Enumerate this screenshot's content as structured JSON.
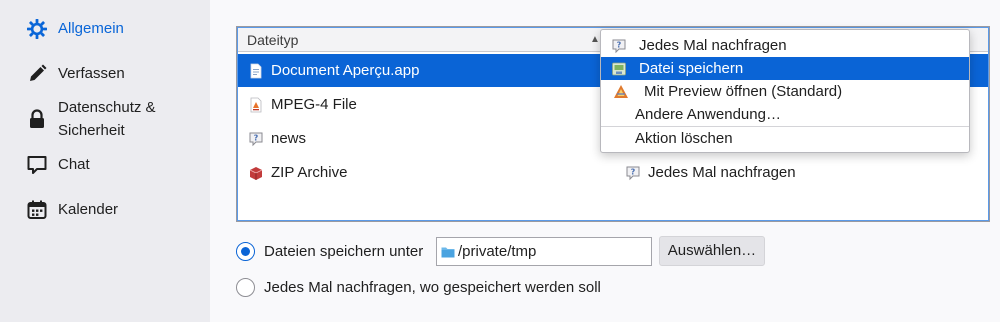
{
  "sidebar": {
    "items": [
      {
        "label": "Allgemein",
        "icon": "gear-icon",
        "active": true
      },
      {
        "label": "Verfassen",
        "icon": "pencil-icon"
      },
      {
        "label_line1": "Datenschutz &",
        "label_line2": "Sicherheit",
        "icon": "lock-icon"
      },
      {
        "label": "Chat",
        "icon": "chat-icon"
      },
      {
        "label": "Kalender",
        "icon": "calendar-icon"
      }
    ]
  },
  "table": {
    "column_header": "Dateityp",
    "rows": [
      {
        "name": "Document Aperçu.app",
        "icon": "document-icon",
        "selected": true
      },
      {
        "name": "MPEG-4 File",
        "icon": "media-file-icon"
      },
      {
        "name": "news",
        "icon": "question-icon"
      },
      {
        "name": "ZIP Archive",
        "icon": "archive-icon",
        "action": "Jedes Mal nachfragen",
        "action_icon": "question-icon"
      }
    ]
  },
  "menu": {
    "items": [
      {
        "label": "Jedes Mal nachfragen",
        "icon": "question-icon"
      },
      {
        "label": "Datei speichern",
        "icon": "save-file-icon",
        "highlighted": true
      },
      {
        "label": "Mit Preview öffnen (Standard)",
        "icon": "preview-app-icon"
      },
      {
        "label": "Andere Anwendung…"
      },
      {
        "label": "Aktion löschen"
      }
    ]
  },
  "save": {
    "option_save_label": "Dateien speichern unter",
    "path": "/private/tmp",
    "choose_button": "Auswählen…",
    "option_ask_label": "Jedes Mal nachfragen, wo gespeichert werden soll"
  },
  "colors": {
    "accent": "#0a64d6",
    "sidebar_bg": "#ececf0"
  }
}
